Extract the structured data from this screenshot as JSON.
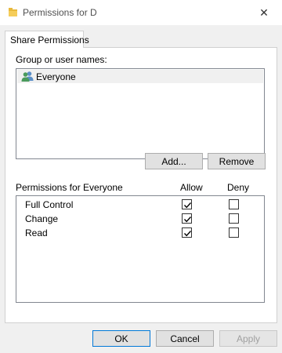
{
  "window": {
    "title": "Permissions for D",
    "close_glyph": "✕",
    "folder_icon": "folder-icon",
    "folder_color": "#e8b93c"
  },
  "tab": {
    "label": "Share Permissions"
  },
  "users": {
    "label": "Group or user names:",
    "items": [
      {
        "name": "Everyone",
        "icon": "users-icon"
      }
    ],
    "selected_bg": "#f0f0f0"
  },
  "buttons": {
    "add": "Add...",
    "remove": "Remove",
    "ok": "OK",
    "cancel": "Cancel",
    "apply": "Apply"
  },
  "permissions": {
    "header": "Permissions for Everyone",
    "allow_header": "Allow",
    "deny_header": "Deny",
    "rows": [
      {
        "name": "Full Control",
        "allow": true,
        "deny": false
      },
      {
        "name": "Change",
        "allow": true,
        "deny": false
      },
      {
        "name": "Read",
        "allow": true,
        "deny": false
      }
    ]
  },
  "colors": {
    "accent": "#0078d7",
    "panel_border": "#d0d0d0",
    "list_border": "#828790"
  }
}
